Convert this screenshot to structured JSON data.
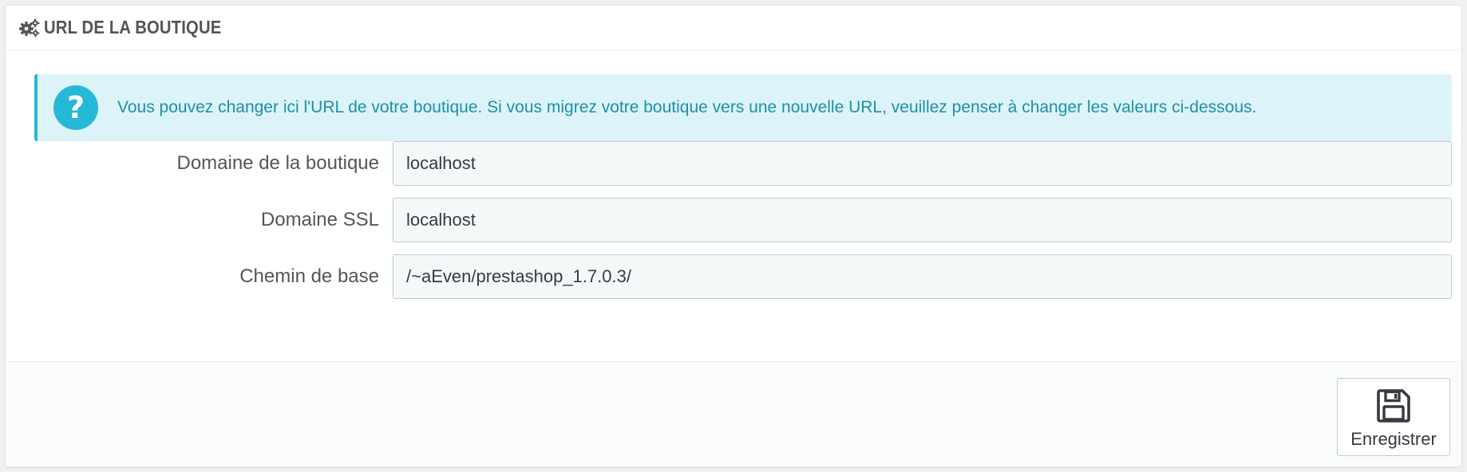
{
  "panel": {
    "title": "URL DE LA BOUTIQUE",
    "title_icon": "cogs-icon"
  },
  "alert": {
    "icon": "question-icon",
    "icon_glyph": "?",
    "text": "Vous pouvez changer ici l'URL de votre boutique. Si vous migrez votre boutique vers une nouvelle URL, veuillez penser à changer les valeurs ci-dessous."
  },
  "form": {
    "domain": {
      "label": "Domaine de la boutique",
      "value": "localhost"
    },
    "ssl_domain": {
      "label": "Domaine SSL",
      "value": "localhost"
    },
    "base_path": {
      "label": "Chemin de base",
      "value": "/~aEven/prestashop_1.7.0.3/"
    }
  },
  "footer": {
    "save_label": "Enregistrer",
    "save_icon": "floppy-disk-icon"
  },
  "colors": {
    "accent": "#25b9d7",
    "alert_background": "#dcf4f9",
    "alert_text": "#1e8fa6",
    "input_background": "#f5f8f9",
    "input_border": "#bbcdd2"
  }
}
